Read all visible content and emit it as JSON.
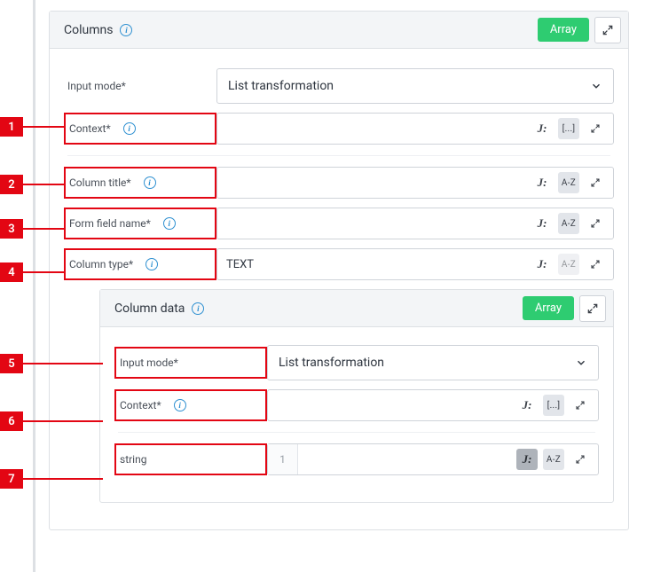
{
  "outer": {
    "title": "Columns",
    "pill": "Array",
    "rows": {
      "input_mode": {
        "label": "Input mode*",
        "value": "List transformation"
      },
      "context": {
        "label": "Context*",
        "badge": "[...]"
      },
      "title": {
        "label": "Column title*",
        "badge": "A-Z"
      },
      "field": {
        "label": "Form field name*",
        "badge": "A-Z"
      },
      "type": {
        "label": "Column type*",
        "value": "TEXT",
        "badge": "A-Z"
      }
    }
  },
  "inner": {
    "title": "Column data",
    "pill": "Array",
    "rows": {
      "input_mode": {
        "label": "Input mode*",
        "value": "List transformation"
      },
      "context": {
        "label": "Context*",
        "badge": "[...]"
      },
      "string": {
        "label": "string",
        "lineno": "1",
        "badge": "A-Z"
      }
    }
  },
  "callouts": [
    "1",
    "2",
    "3",
    "4",
    "5",
    "6",
    "7"
  ]
}
